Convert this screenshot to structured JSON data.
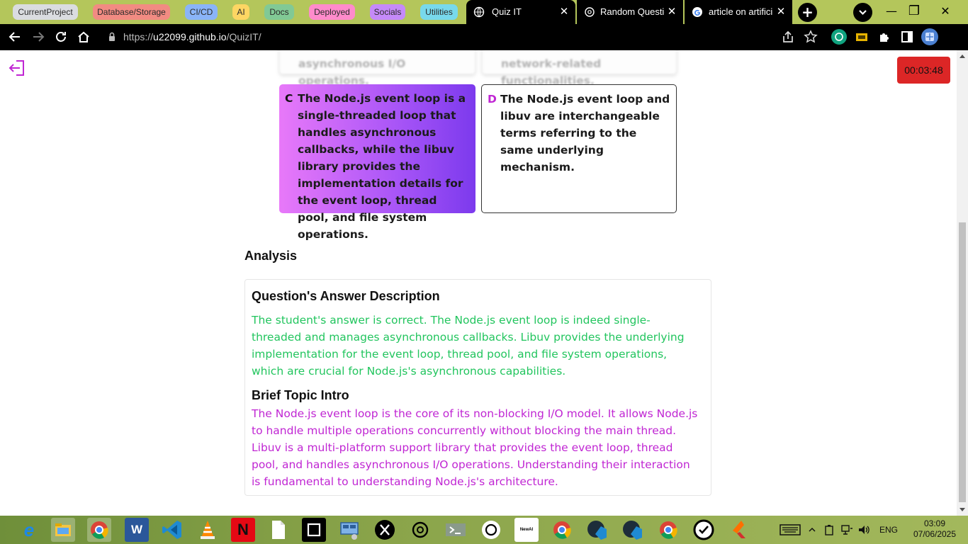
{
  "browser": {
    "tab_groups": [
      {
        "label": "CurrentProject",
        "color": "#dadce0"
      },
      {
        "label": "Database/Storage",
        "color": "#f28b82"
      },
      {
        "label": "CI/CD",
        "color": "#8ab4f8"
      },
      {
        "label": "AI",
        "color": "#fdd663"
      },
      {
        "label": "Docs",
        "color": "#81c995"
      },
      {
        "label": "Deployed",
        "color": "#ff8bcb"
      },
      {
        "label": "Socials",
        "color": "#c58af9"
      },
      {
        "label": "Utilities",
        "color": "#78d9ec"
      }
    ],
    "tabs": [
      {
        "title": "Quiz IT",
        "active": true,
        "close": "✕"
      },
      {
        "title": "Random Questio",
        "active": false,
        "close": "✕"
      },
      {
        "title": "article on artifici",
        "active": false,
        "close": "✕"
      }
    ],
    "new_tab": "+",
    "window_controls": {
      "minimize": "—",
      "maximize": "❐",
      "close": "✕"
    },
    "url_host": "u22099.github.io",
    "url_prefix": "https://",
    "url_path": "/QuizIT/"
  },
  "quiz": {
    "timer": "00:03:48",
    "options": [
      {
        "letter": "",
        "text": "asynchronous I/O operations."
      },
      {
        "letter": "",
        "text": "network-related functionalities."
      },
      {
        "letter": "C",
        "text": "The Node.js event loop is a single-threaded loop that handles asynchronous callbacks, while the libuv library provides the implementation details for the event loop, thread pool, and file system operations.",
        "selected": true
      },
      {
        "letter": "D",
        "text": "The Node.js event loop and libuv are interchangeable terms referring to the same underlying mechanism."
      }
    ]
  },
  "analysis": {
    "heading": "Analysis",
    "answer_title": "Question's Answer Description",
    "answer_text": "The student's answer is correct. The Node.js event loop is indeed single-threaded and manages asynchronous callbacks. Libuv provides the underlying implementation for the event loop, thread pool, and file system operations, which are crucial for Node.js's asynchronous capabilities.",
    "intro_title": "Brief Topic Intro",
    "intro_text": "The Node.js event loop is the core of its non-blocking I/O model. It allows Node.js to handle multiple operations concurrently without blocking the main thread. Libuv is a multi-platform support library that provides the event loop, thread pool, and handles asynchronous I/O operations. Understanding their interaction is fundamental to understanding Node.js's architecture.",
    "colors": {
      "answer": "#22c55e",
      "intro": "#c026d3"
    }
  },
  "taskbar": {
    "apps": [
      "internet-explorer-icon",
      "file-explorer-icon",
      "chrome-icon",
      "word-icon",
      "vscode-icon",
      "vlc-icon",
      "netflix-icon",
      "notepad-icon",
      "square-app-icon",
      "network-app-icon",
      "x-icon",
      "chatgpt-icon",
      "terminal-icon",
      "openai-icon",
      "newai-icon",
      "chrome-icon",
      "github-icon",
      "github-icon",
      "chrome-icon",
      "checkmark-app-icon",
      "flutter-icon"
    ],
    "newai_label": "NewAI",
    "language": "ENG",
    "time": "03:09",
    "date": "07/06/2025"
  }
}
